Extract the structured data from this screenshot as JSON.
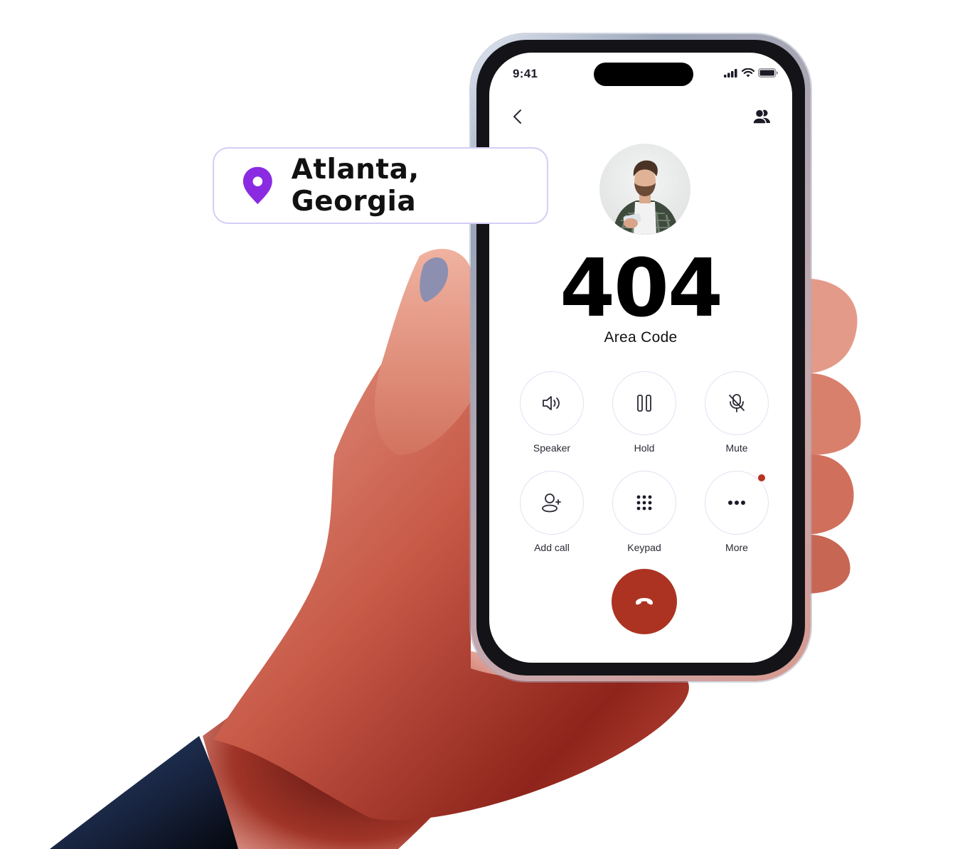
{
  "status_bar": {
    "time": "9:41",
    "icons": [
      "cellular-signal-icon",
      "wifi-icon",
      "battery-icon"
    ]
  },
  "nav": {
    "back_icon": "chevron-left-icon",
    "contacts_icon": "contacts-icon"
  },
  "caller": {
    "avatar_alt": "caller photo",
    "area_code": "404",
    "area_code_label": "Area Code"
  },
  "controls": [
    {
      "id": "speaker",
      "label": "Speaker",
      "icon": "speaker-icon"
    },
    {
      "id": "hold",
      "label": "Hold",
      "icon": "pause-icon"
    },
    {
      "id": "mute",
      "label": "Mute",
      "icon": "mic-off-icon"
    },
    {
      "id": "add-call",
      "label": "Add call",
      "icon": "add-user-icon"
    },
    {
      "id": "keypad",
      "label": "Keypad",
      "icon": "keypad-icon"
    },
    {
      "id": "more",
      "label": "More",
      "icon": "more-icon",
      "has_notification": true
    }
  ],
  "end_call": {
    "icon": "hang-up-icon"
  },
  "location": {
    "icon": "map-pin-icon",
    "text": "Atlanta, Georgia"
  },
  "colors": {
    "accent_purple": "#8a2be2",
    "end_call_red": "#ac3322",
    "notification_red": "#b8321e",
    "card_border": "#d6cdf6"
  }
}
